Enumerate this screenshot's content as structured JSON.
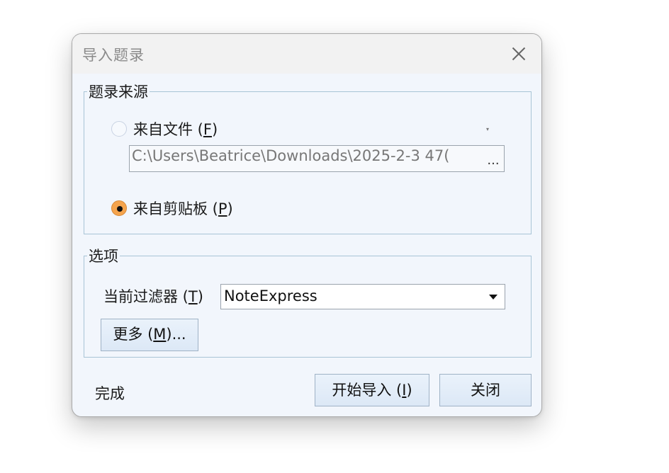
{
  "dialog": {
    "title": "导入题录",
    "close_icon": "close-icon"
  },
  "source_group": {
    "legend": "题录来源",
    "from_file": {
      "label": "来自文件 (",
      "accel": "F",
      "suffix": ")",
      "checked": false
    },
    "file_path": "C:\\Users\\Beatrice\\Downloads\\2025-2-3 47(",
    "browse_label": "...",
    "from_clipboard": {
      "label": "来自剪贴板 (",
      "accel": "P",
      "suffix": ")",
      "checked": true
    }
  },
  "options_group": {
    "legend": "选项",
    "filter_label": "当前过滤器 (",
    "filter_accel": "T",
    "filter_suffix": ")",
    "filter_value": "NoteExpress",
    "more_button": {
      "label": "更多 (",
      "accel": "M",
      "suffix": ")..."
    }
  },
  "footer": {
    "status_text": "完成",
    "start_button": {
      "label": "开始导入 (",
      "accel": "I",
      "suffix": ")"
    },
    "close_button": "关闭"
  },
  "colors": {
    "dialog_bg": "#f2f6fc",
    "radio_checked": "#f5a44d",
    "group_border": "#a8c4d6"
  }
}
